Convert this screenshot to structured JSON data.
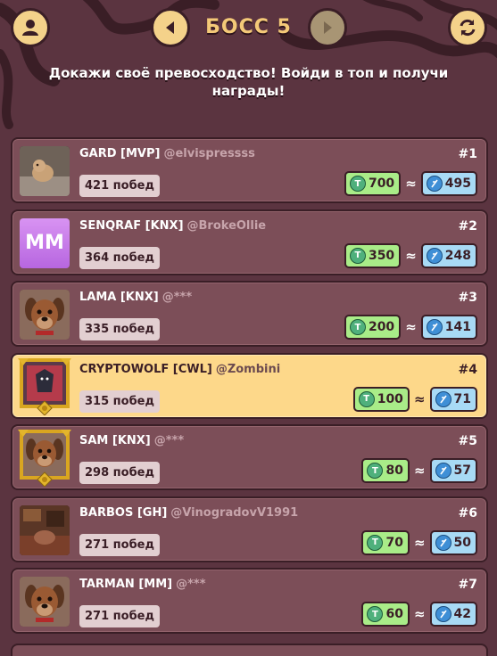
{
  "header": {
    "title": "БОСС 5",
    "subtitle": "Докажи своё превосходство! Войди в топ и получи награды!"
  },
  "icons": {
    "profile": "user-icon",
    "prev": "arrow-left-icon",
    "next": "arrow-right-icon",
    "refresh": "refresh-icon"
  },
  "colors": {
    "background": "#5b3440",
    "card": "#7c4e58",
    "highlight_card": "#fdd88a",
    "title": "#f4c978",
    "green_pill": "#a9ec88",
    "blue_pill": "#a8daf5"
  },
  "players": [
    {
      "name": "GARD [MVP]",
      "handle": "@elvispressss",
      "rank": "#1",
      "wins": "421 побед",
      "reward_t": "700",
      "reward_p": "495",
      "avatar": "dog-photo"
    },
    {
      "name": "SENQRAF [KNX]",
      "handle": "@BrokeOllie",
      "rank": "#2",
      "wins": "364 побед",
      "reward_t": "350",
      "reward_p": "248",
      "avatar": "MM"
    },
    {
      "name": "LAMA [KNX]",
      "handle": "@***",
      "rank": "#3",
      "wins": "335 побед",
      "reward_t": "200",
      "reward_p": "141",
      "avatar": "cartoon-dog"
    },
    {
      "name": "CRYPTOWOLF [CWL]",
      "handle": "@Zombini",
      "rank": "#4",
      "wins": "315 побед",
      "reward_t": "100",
      "reward_p": "71",
      "avatar": "framed-wolf"
    },
    {
      "name": "SAM [KNX]",
      "handle": "@***",
      "rank": "#5",
      "wins": "298 побед",
      "reward_t": "80",
      "reward_p": "57",
      "avatar": "framed-dog"
    },
    {
      "name": "BARBOS [GH]",
      "handle": "@VinogradovV1991",
      "rank": "#6",
      "wins": "271 побед",
      "reward_t": "70",
      "reward_p": "50",
      "avatar": "room-photo"
    },
    {
      "name": "TARMAN [MM]",
      "handle": "@***",
      "rank": "#7",
      "wins": "271 побед",
      "reward_t": "60",
      "reward_p": "42",
      "avatar": "cartoon-dog"
    }
  ],
  "approx_symbol": "≈",
  "coin_t_letter": "T"
}
